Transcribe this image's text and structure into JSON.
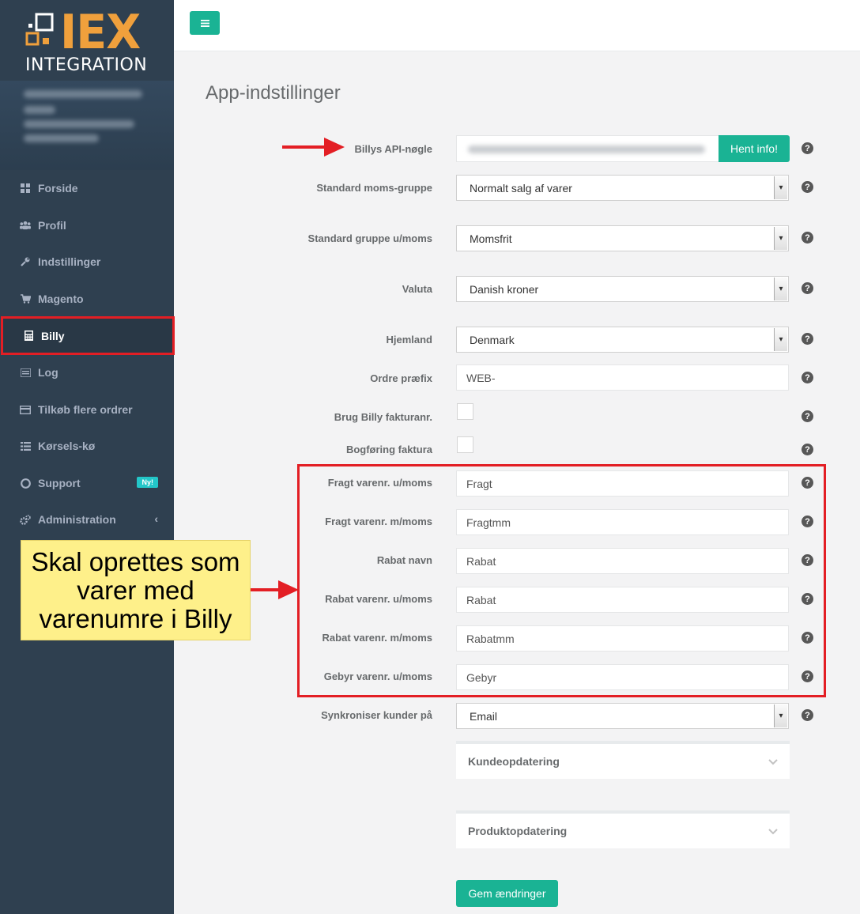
{
  "brand": {
    "logo_main": "IEX",
    "logo_sub": "INTEGRATION",
    "accent": "#f0a03c"
  },
  "sidebar": {
    "items": [
      {
        "label": "Forside",
        "icon": "grid-icon"
      },
      {
        "label": "Profil",
        "icon": "users-icon"
      },
      {
        "label": "Indstillinger",
        "icon": "wrench-icon"
      },
      {
        "label": "Magento",
        "icon": "cart-icon"
      },
      {
        "label": "Billy",
        "icon": "calculator-icon",
        "active": true
      },
      {
        "label": "Log",
        "icon": "list-icon"
      },
      {
        "label": "Tilkøb flere ordrer",
        "icon": "credit-card-icon"
      },
      {
        "label": "Kørsels-kø",
        "icon": "queue-icon"
      },
      {
        "label": "Support",
        "icon": "lifebuoy-icon",
        "badge": "Ny!"
      },
      {
        "label": "Administration",
        "icon": "gears-icon"
      }
    ]
  },
  "page": {
    "title": "App-indstillinger"
  },
  "form": {
    "api_key": {
      "label": "Billys API-nøgle",
      "button": "Hent info!"
    },
    "moms_gruppe": {
      "label": "Standard moms-gruppe",
      "value": "Normalt salg af varer"
    },
    "gruppe_umoms": {
      "label": "Standard gruppe u/moms",
      "value": "Momsfrit"
    },
    "valuta": {
      "label": "Valuta",
      "value": "Danish kroner"
    },
    "hjemland": {
      "label": "Hjemland",
      "value": "Denmark"
    },
    "ordre_prefix": {
      "label": "Ordre præfix",
      "value": "WEB-"
    },
    "brug_fakturanr": {
      "label": "Brug Billy fakturanr.",
      "checked": false
    },
    "bogforing": {
      "label": "Bogføring faktura",
      "checked": false
    },
    "fragt_umoms": {
      "label": "Fragt varenr. u/moms",
      "value": "Fragt"
    },
    "fragt_mmoms": {
      "label": "Fragt varenr. m/moms",
      "value": "Fragtmm"
    },
    "rabat_navn": {
      "label": "Rabat navn",
      "value": "Rabat"
    },
    "rabat_umoms": {
      "label": "Rabat varenr. u/moms",
      "value": "Rabat"
    },
    "rabat_mmoms": {
      "label": "Rabat varenr. m/moms",
      "value": "Rabatmm"
    },
    "gebyr_umoms": {
      "label": "Gebyr varenr. u/moms",
      "value": "Gebyr"
    },
    "synk_kunder": {
      "label": "Synkroniser kunder på",
      "value": "Email"
    }
  },
  "panels": {
    "kunde": "Kundeopdatering",
    "produkt": "Produktopdatering"
  },
  "save_label": "Gem ændringer",
  "callout": "Skal oprettes som varer med varenumre i Billy"
}
